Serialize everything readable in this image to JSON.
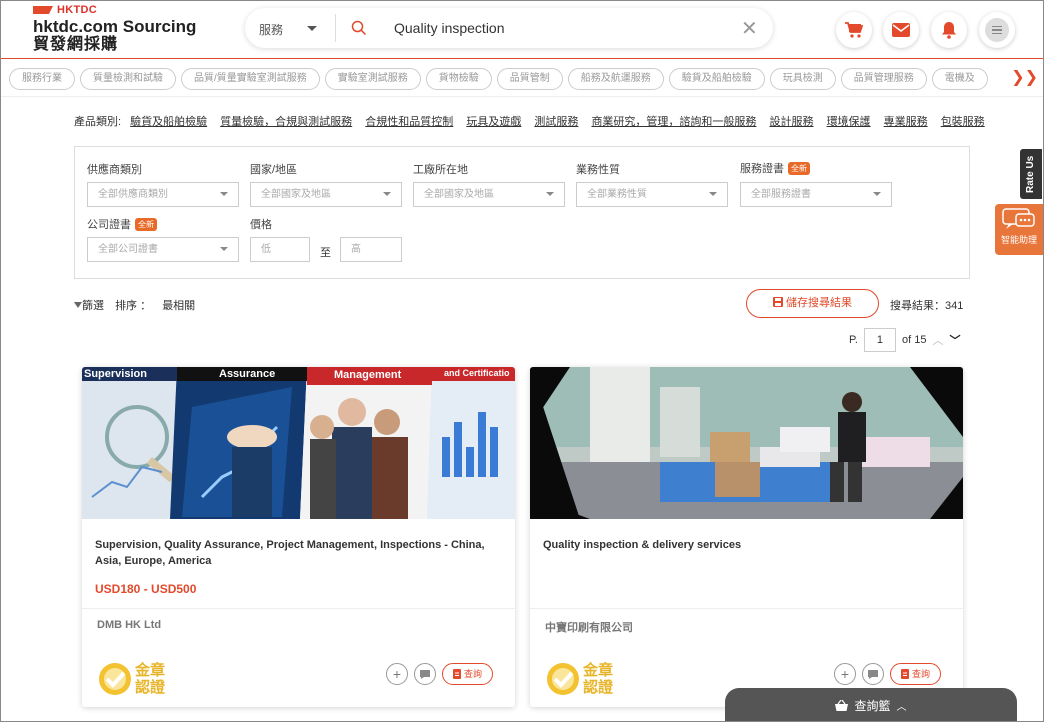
{
  "header": {
    "logo_top": "HKTDC",
    "logo_main": "hktdc.com Sourcing",
    "logo_sub": "貿發網採購",
    "search_category": "服務",
    "search_query": "Quality inspection",
    "cart_icon": "cart-icon",
    "mail_icon": "mail-icon",
    "bell_icon": "bell-icon",
    "menu_icon": "menu-icon"
  },
  "category_pills": [
    "服務行業",
    "質量檢測和試驗",
    "品質/質量實驗室測試服務",
    "實驗室測試服務",
    "貨物檢驗",
    "品質管制",
    "船務及航運服務",
    "驗貨及船舶檢驗",
    "玩具檢測",
    "品質管理服務",
    "電機及"
  ],
  "product_categories": {
    "label": "產品類別:",
    "links": [
      "驗貨及船舶檢驗",
      "質量檢驗，合規與測試服務",
      "合規性和品質控制",
      "玩具及遊戲",
      "測試服務",
      "商業研究，管理，諮詢和一般服務",
      "設計服務",
      "環境保護",
      "專業服務",
      "包裝服務"
    ]
  },
  "filters": {
    "supplier_type": {
      "label": "供應商類別",
      "value": "全部供應商類別"
    },
    "country": {
      "label": "國家/地區",
      "value": "全部國家及地區"
    },
    "factory_location": {
      "label": "工廠所在地",
      "value": "全部國家及地區"
    },
    "business_type": {
      "label": "業務性質",
      "value": "全部業務性質"
    },
    "service_cert": {
      "label": "服務證書",
      "badge": "全新",
      "value": "全部服務證書"
    },
    "company_cert": {
      "label": "公司證書",
      "badge": "全新",
      "value": "全部公司證書"
    },
    "price": {
      "label": "價格",
      "low_placeholder": "低",
      "to": "至",
      "high_placeholder": "高"
    }
  },
  "sortbar": {
    "filter_label": "篩選",
    "sort_label": "排序 ：",
    "sort_value": "最相關",
    "save_search": "儲存搜尋結果",
    "results_label": "搜尋結果：341"
  },
  "pager": {
    "prefix": "P.",
    "page": "1",
    "total": "of 15"
  },
  "cards": [
    {
      "banner_words": [
        "Supervision",
        "Assurance",
        "Management",
        "and Certificatio"
      ],
      "title": "Supervision, Quality Assurance, Project Management, Inspections - China, Asia, Europe, America",
      "price": "USD180 - USD500",
      "company": "DMB HK Ltd",
      "gold_line1": "金章",
      "gold_line2": "認證",
      "inquire": "查詢"
    },
    {
      "title": "Quality inspection & delivery services",
      "price": "",
      "company": "中寶印刷有限公司",
      "gold_line1": "金章",
      "gold_line2": "認證",
      "inquire": "查詢"
    }
  ],
  "side": {
    "rate_us": "Rate Us",
    "assistant": "智能助理"
  },
  "basket": {
    "label": "查詢籃"
  }
}
